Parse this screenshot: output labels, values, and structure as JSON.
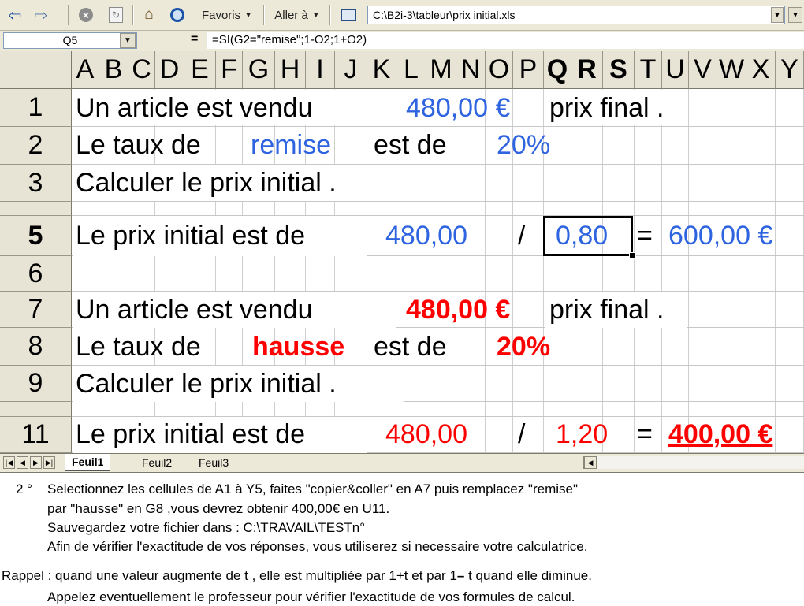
{
  "toolbar": {
    "back_icon": "back-arrow-icon",
    "forward_icon": "forward-arrow-icon",
    "favoris_label": "Favoris",
    "aller_label": "Aller à",
    "address": "C:\\B2i-3\\tableur\\prix initial.xls"
  },
  "formula_bar": {
    "name_box": "Q5",
    "equals": "=",
    "formula": "=SI(G2=\"remise\";1-O2;1+O2)"
  },
  "columns": [
    "A",
    "B",
    "C",
    "D",
    "E",
    "F",
    "G",
    "H",
    "I",
    "J",
    "K",
    "L",
    "M",
    "N",
    "O",
    "P",
    "Q",
    "R",
    "S",
    "T",
    "U",
    "V",
    "W",
    "X",
    "Y"
  ],
  "selected_columns": [
    "Q",
    "R",
    "S"
  ],
  "rows": [
    "1",
    "2",
    "3",
    "",
    "5",
    "6",
    "7",
    "8",
    "9",
    "",
    "11"
  ],
  "cells": {
    "r1_a": "Un article est vendu",
    "r1_price": "480,00 €",
    "r1_final": "prix final .",
    "r2_a": "Le taux de",
    "r2_word": "remise",
    "r2_estde": "est de",
    "r2_rate": "20%",
    "r3_a": "Calculer le prix initial .",
    "r5_a": "Le prix initial est de",
    "r5_price": "480,00",
    "r5_slash": "/",
    "r5_coef": "0,80",
    "r5_eq": "=",
    "r5_result": "600,00 €",
    "r7_a": "Un article est vendu",
    "r7_price": "480,00 €",
    "r7_final": "prix final .",
    "r8_a": "Le taux de",
    "r8_word": "hausse",
    "r8_estde": "est de",
    "r8_rate": "20%",
    "r9_a": "Calculer le prix initial .",
    "r11_a": "Le prix initial est de",
    "r11_price": "480,00",
    "r11_slash": "/",
    "r11_coef": "1,20",
    "r11_eq": "=",
    "r11_result": "400,00 €"
  },
  "sheets": [
    "Feuil1",
    "Feuil2",
    "Feuil3"
  ],
  "active_sheet": "Feuil1",
  "instructions": {
    "num": "2 °",
    "l1": "Selectionnez les cellules de A1 à Y5, faites \"copier&coller\" en A7 puis remplacez \"remise\"",
    "l2": "par \"hausse\" en  G8 ,vous devrez obtenir 400,00€ en U11.",
    "l3": "Sauvegardez votre fichier dans : C:\\TRAVAIL\\TESTn°",
    "l4": "Afin de vérifier l'exactitude de vos réponses, vous utiliserez si necessaire votre calculatrice.",
    "rappel": "Rappel : quand une valeur augmente de t , elle est multipliée par 1+t et par 1",
    "rappel_mid": "–",
    "rappel_end": " t quand elle diminue.",
    "l6": "Appelez eventuellement le professeur pour vérifier l'exactitude de vos formules de calcul."
  },
  "colors": {
    "blue_text": "#2f64e0",
    "red_text": "#ff0000",
    "header_bg": "#e7e4d5",
    "toolbar_bg": "#ece9d8"
  }
}
